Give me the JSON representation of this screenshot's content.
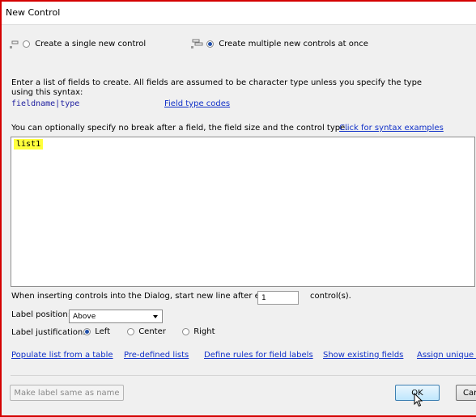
{
  "window": {
    "title": "New Control"
  },
  "mode": {
    "single_label": "Create a single new control",
    "multiple_label": "Create multiple new controls at once",
    "selected": "multiple"
  },
  "instructions": {
    "line1": "Enter a list of fields to create. All fields are assumed to be character type unless you specify the type",
    "line2": "using this syntax:",
    "syntax": "fieldname|type",
    "field_type_link": "Field type codes",
    "optional_text": "You can optionally specify no break after a field, the field size and the control type.",
    "syntax_examples_link": "Click for syntax examples"
  },
  "field_list": {
    "value": "list1"
  },
  "newline": {
    "prefix": "When inserting controls into the Dialog, start new line after every",
    "value": "1",
    "suffix": "control(s)."
  },
  "label_position": {
    "label": "Label position:",
    "value": "Above"
  },
  "justification": {
    "label": "Label justification:",
    "options": [
      "Left",
      "Center",
      "Right"
    ],
    "selected": "Left"
  },
  "links": [
    "Populate list from a table",
    "Pre-defined lists",
    "Define rules for field labels",
    "Show existing fields",
    "Assign unique n"
  ],
  "buttons": {
    "make_label": "Make label same as name",
    "ok": "OK",
    "cancel": "Car"
  },
  "colors": {
    "link": "#1030c8",
    "highlight": "#ffff3c",
    "frame": "#d40000"
  }
}
